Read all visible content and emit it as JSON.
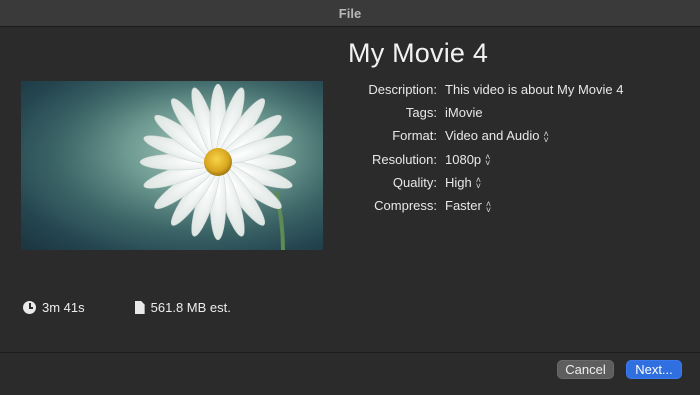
{
  "window": {
    "title": "File"
  },
  "movie": {
    "title": "My Movie 4"
  },
  "thumbnail": {
    "description": "white daisy flower on teal blurred background"
  },
  "properties": {
    "description": {
      "label": "Description:",
      "value": "This video is about My Movie 4"
    },
    "tags": {
      "label": "Tags:",
      "value": "iMovie"
    },
    "format": {
      "label": "Format:",
      "value": "Video and Audio"
    },
    "resolution": {
      "label": "Resolution:",
      "value": "1080p"
    },
    "quality": {
      "label": "Quality:",
      "value": "High"
    },
    "compress": {
      "label": "Compress:",
      "value": "Faster"
    }
  },
  "stats": {
    "duration": "3m 41s",
    "size": "561.8 MB est."
  },
  "buttons": {
    "cancel": "Cancel",
    "next": "Next..."
  },
  "colors": {
    "background": "#2b2b2b",
    "accent": "#2f6fe0",
    "cancel_bg": "#5e5e5e"
  }
}
